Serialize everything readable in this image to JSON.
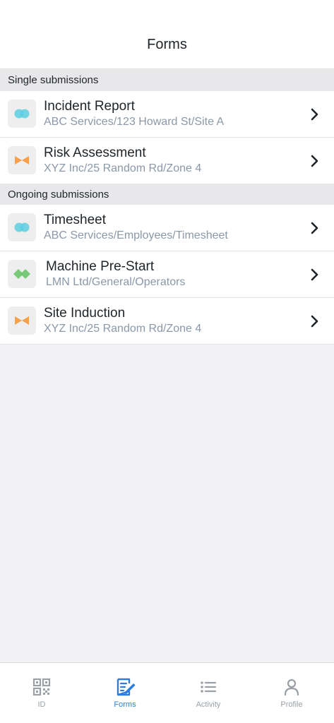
{
  "header": {
    "title": "Forms"
  },
  "sections": {
    "single": {
      "label": "Single submissions",
      "items": [
        {
          "title": "Incident Report",
          "subtitle": "ABC Services/123 Howard St/Site A",
          "icon": "blue-dots-icon"
        },
        {
          "title": "Risk Assessment",
          "subtitle": "XYZ Inc/25 Random Rd/Zone 4",
          "icon": "orange-bowtie-icon"
        }
      ]
    },
    "ongoing": {
      "label": "Ongoing submissions",
      "items": [
        {
          "title": "Timesheet",
          "subtitle": "ABC Services/Employees/Timesheet",
          "icon": "blue-dots-icon"
        },
        {
          "title": "Machine Pre-Start",
          "subtitle": "LMN Ltd/General/Operators",
          "icon": "green-diamonds-icon"
        },
        {
          "title": "Site Induction",
          "subtitle": "XYZ Inc/25 Random Rd/Zone 4",
          "icon": "orange-bowtie-icon"
        }
      ]
    }
  },
  "nav": {
    "items": [
      {
        "label": "ID",
        "icon": "qr-code-icon"
      },
      {
        "label": "Forms",
        "icon": "form-edit-icon",
        "active": true
      },
      {
        "label": "Activity",
        "icon": "list-icon"
      },
      {
        "label": "Profile",
        "icon": "person-icon"
      }
    ]
  },
  "colors": {
    "accent": "#2a7de1",
    "blue_icon": "#5ccfe0",
    "orange_icon": "#f6a04d",
    "green_icon": "#6cc56a",
    "subtitle": "#8a98a8"
  }
}
